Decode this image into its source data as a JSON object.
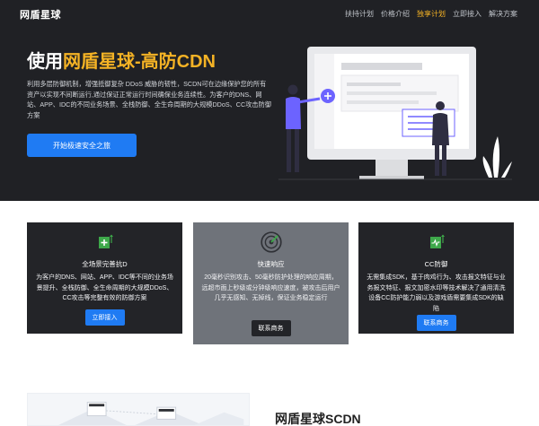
{
  "header": {
    "brand": "网盾星球",
    "nav": [
      "扶持计划",
      "价格介绍",
      "独享计划",
      "立即接入",
      "解决方案"
    ],
    "active_nav_index": 2
  },
  "hero": {
    "title_prefix": "使用",
    "title_highlight": "网盾星球-高防CDN",
    "description": "利用多层防御机制，增强抵御复杂 DDoS 威胁的韧性，SCDN可在边缘保护您的所有资产以实现不间断运行,通过保证正常运行时间确保业务连续性。为客户的DNS、网站、APP、IDC的不同业务场景、全栈防御、全生命周期的大规模DDoS、CC攻击防御方案",
    "cta_label": "开始极速安全之旅"
  },
  "cards": [
    {
      "title": "全场景完善抗D",
      "text": "为客户的DNS、网站、APP、IDC等不同的业务场景提升、全栈防御、全生命周期的大规模DDoS、CC攻击等完整有效的防御方案",
      "button": "立即接入",
      "icon": "shield-plus-icon"
    },
    {
      "title": "快速响应",
      "text": "20毫秒识别攻击、50毫秒防护处理的响应周期，远超市面上秒级或分钟级响应速度，被攻击后用户几乎无感知、无掉线，保证业务稳定运行",
      "button": "联系商务",
      "icon": "radar-icon"
    },
    {
      "title": "CC防御",
      "text": "无需集成SDK，基于肉鸡行为、攻击报文特征与业务报文特征、报文加密水印等技术解决了通用清洗设备CC防护能力弱以及游戏盾需要集成SDK的缺陷",
      "button": "联系商务",
      "icon": "pulse-shield-icon"
    }
  ],
  "bottom": {
    "title": "网盾星球SCDN"
  },
  "colors": {
    "hero_bg": "#202125",
    "accent_yellow": "#f5b325",
    "primary_blue": "#1f7bf3",
    "card_dark": "#232428",
    "card_gray": "#6f737a"
  }
}
